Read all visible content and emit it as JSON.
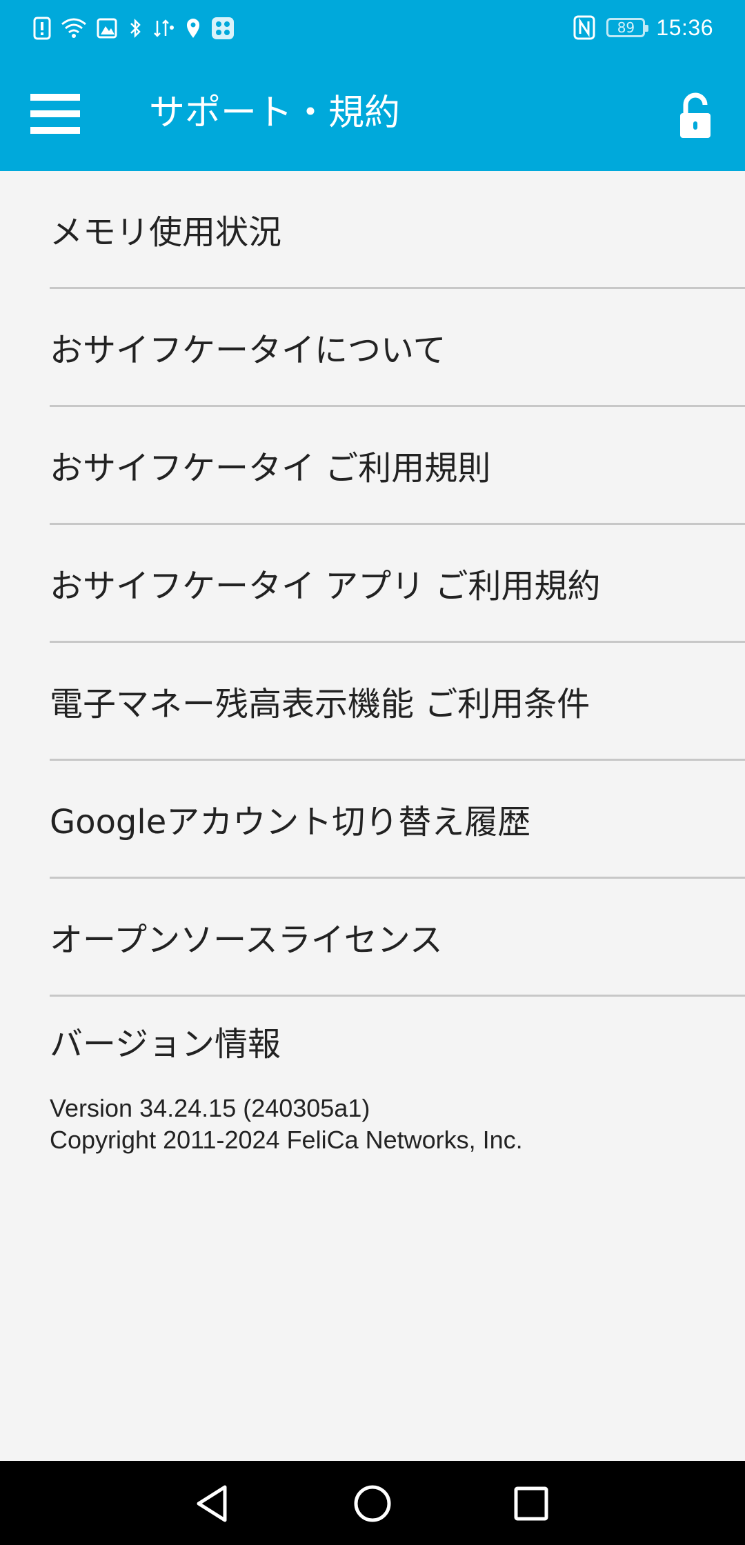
{
  "status_bar": {
    "time": "15:36",
    "battery": "89",
    "icons": [
      "alert-icon",
      "wifi-icon",
      "image-icon",
      "bluetooth-like-icon",
      "network-icon",
      "location-icon",
      "app-grid-icon",
      "nfc-icon",
      "battery-icon"
    ]
  },
  "app_bar": {
    "title": "サポート・規約",
    "menu_icon": "hamburger-menu-icon",
    "lock_icon": "unlock-icon"
  },
  "menu": {
    "items": [
      {
        "label": "メモリ使用状況"
      },
      {
        "label": "おサイフケータイについて"
      },
      {
        "label": "おサイフケータイ ご利用規則"
      },
      {
        "label": "おサイフケータイ アプリ ご利用規約"
      },
      {
        "label": "電子マネー残高表示機能 ご利用条件"
      },
      {
        "label": "Googleアカウント切り替え履歴"
      },
      {
        "label": "オープンソースライセンス"
      }
    ]
  },
  "version": {
    "title": "バージョン情報",
    "version_line": "Version 34.24.15 (240305a1)",
    "copyright_line": "Copyright 2011-2024 FeliCa Networks, Inc."
  },
  "nav": {
    "back": "back-icon",
    "home": "home-icon",
    "recents": "recents-icon"
  },
  "colors": {
    "accent": "#00a9db",
    "background": "#f4f4f4",
    "divider": "#c7c7c7",
    "text": "#222222"
  }
}
